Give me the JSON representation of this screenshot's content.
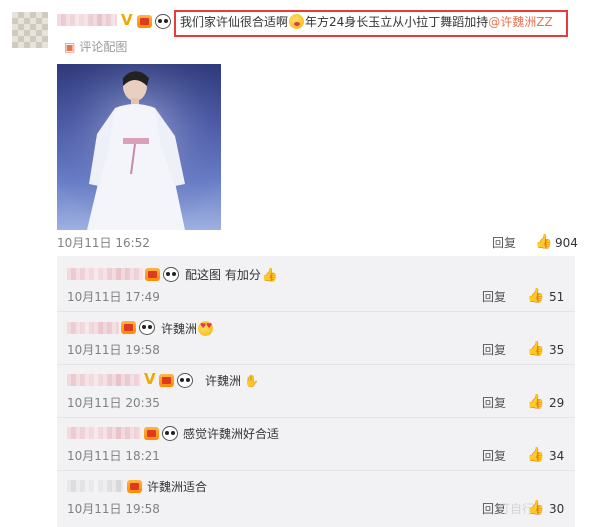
{
  "post": {
    "text_prefix": "我们家许仙很合适啊",
    "text_middle": "年方24身长玉立从小拉丁舞蹈加持",
    "mention": "@许魏洲ZZ",
    "comment_pic_label": "评论配图",
    "timestamp": "10月11日 16:52",
    "reply_label": "回复",
    "like_count": "904"
  },
  "replies": [
    {
      "text": "配这图 有加分",
      "timestamp": "10月11日 17:49",
      "reply_label": "回复",
      "like_count": "51"
    },
    {
      "text": "许魏洲",
      "timestamp": "10月11日 19:58",
      "reply_label": "回复",
      "like_count": "35"
    },
    {
      "text": "许魏洲",
      "timestamp": "10月11日 20:35",
      "reply_label": "回复",
      "like_count": "29"
    },
    {
      "text": "感觉许魏洲好合适",
      "timestamp": "10月11日 18:21",
      "reply_label": "回复",
      "like_count": "34"
    },
    {
      "text": "许魏洲适合",
      "timestamp": "10月11日 19:58",
      "reply_label": "回复",
      "like_count": "30"
    }
  ],
  "watermark": "打自行",
  "icons": {
    "like": "thumbs-up-icon",
    "verified": "verified-v-icon",
    "member": "gift-badge-icon",
    "panda": "panda-icon"
  },
  "colors": {
    "mention": "#eb7350",
    "highlight": "#e83b3b",
    "verified": "#f0a800"
  }
}
